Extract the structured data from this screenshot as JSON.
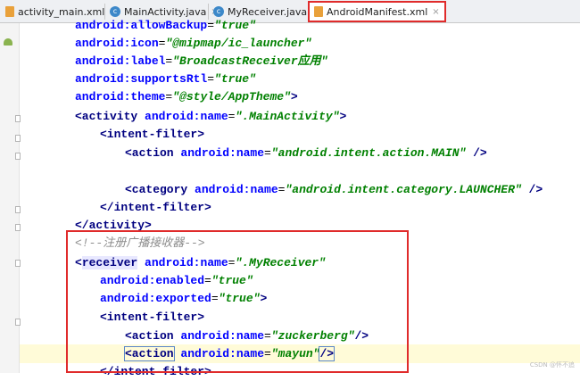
{
  "tabs": [
    {
      "label": "activity_main.xml",
      "icon": "xml-file-icon",
      "active": false
    },
    {
      "label": "MainActivity.java",
      "icon": "java-class-icon",
      "active": false
    },
    {
      "label": "MyReceiver.java",
      "icon": "java-class-icon",
      "active": false
    },
    {
      "label": "AndroidManifest.xml",
      "icon": "xml-file-icon",
      "active": true
    }
  ],
  "code": {
    "l1": {
      "attr": "android:allowBackup",
      "val": "\"true\""
    },
    "l2": {
      "attr": "android:icon",
      "val": "\"@mipmap/ic_launcher\""
    },
    "l3": {
      "attr": "android:label",
      "val": "\"BroadcastReceiver应用\""
    },
    "l4": {
      "attr": "android:supportsRtl",
      "val": "\"true\""
    },
    "l5": {
      "attr": "android:theme",
      "val": "\"@style/AppTheme\"",
      "end": ">"
    },
    "l6": {
      "tag": "<activity",
      "attr": "android:name",
      "val": "\".MainActivity\"",
      "end": ">"
    },
    "l7": {
      "tag": "<intent-filter>"
    },
    "l8": {
      "tag": "<action",
      "attr": "android:name",
      "val": "\"android.intent.action.MAIN\"",
      "end": " />"
    },
    "l9": {
      "tag": "<category",
      "attr": "android:name",
      "val": "\"android.intent.category.LAUNCHER\"",
      "end": " />"
    },
    "l10": {
      "tag": "</intent-filter>"
    },
    "l11": {
      "tag": "</activity>"
    },
    "l12": {
      "comment": "<!--注册广播接收器-->"
    },
    "l13": {
      "lt": "<",
      "tag": "receiver",
      "attr": "android:name",
      "val": "\".MyReceiver\""
    },
    "l14": {
      "attr": "android:enabled",
      "val": "\"true\""
    },
    "l15": {
      "attr": "android:exported",
      "val": "\"true\"",
      "end": ">"
    },
    "l16": {
      "tag": "<intent-filter>"
    },
    "l17": {
      "tag": "<action",
      "attr": "android:name",
      "val": "\"zuckerberg\"",
      "end": "/>"
    },
    "l18": {
      "tag": "<action",
      "attr": "android:name",
      "val": "\"mayun\"",
      "end": "/>"
    },
    "l19": {
      "tag": "</intent-filter>"
    }
  },
  "watermark": "CSDN @怀不追"
}
